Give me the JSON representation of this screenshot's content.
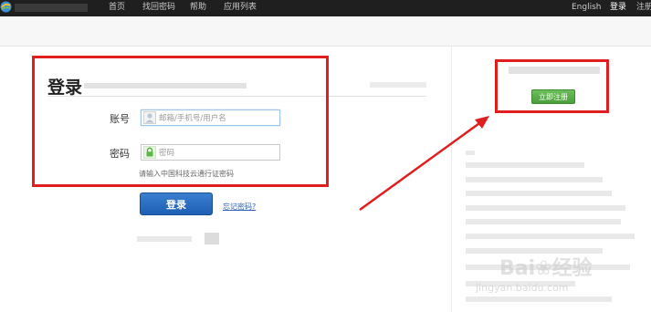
{
  "nav": {
    "links": [
      "首页",
      "找回密码",
      "帮助",
      "应用列表"
    ],
    "lang": "English",
    "login": "登录",
    "register": "注册"
  },
  "login": {
    "title": "登录",
    "account_label": "账号",
    "account_placeholder": "邮箱/手机号/用户名",
    "password_label": "密码",
    "password_placeholder": "密码",
    "hint": "请输入中国科技云通行证密码",
    "submit": "登录",
    "forgot": "忘记密码?"
  },
  "sidebar": {
    "register_button": "立即注册"
  },
  "colors": {
    "annotation_red": "#e01e1e",
    "login_blue": "#1e5fb3",
    "register_green": "#4a9e3c",
    "link_blue": "#2b62b5"
  },
  "icons": [
    "logo-icon",
    "user-icon",
    "lock-icon"
  ]
}
